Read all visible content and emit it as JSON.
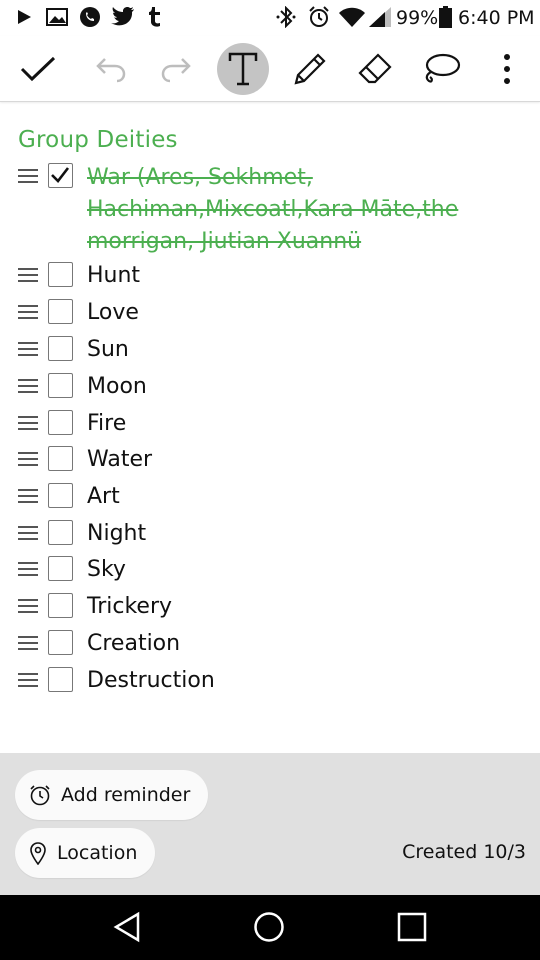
{
  "status_bar": {
    "battery_percent": "99%",
    "time": "6:40 PM",
    "left_icons": [
      "play-store-icon",
      "gallery-icon",
      "phone-icon",
      "twitter-icon",
      "tumblr-icon"
    ],
    "right_icons": [
      "bluetooth-icon",
      "alarm-icon",
      "wifi-icon",
      "cell-signal-icon",
      "battery-icon"
    ]
  },
  "toolbar": {
    "buttons": [
      "check-icon",
      "undo-icon",
      "redo-icon",
      "text-icon",
      "pencil-icon",
      "eraser-icon",
      "lasso-icon",
      "more-icon"
    ],
    "active": "text-icon"
  },
  "note": {
    "group_title": "Group Deities",
    "items": [
      {
        "label": "War (Ares, Sekhmet, Hachiman,Mixcoatl,Kara Māte,the morrigan, Jiutian Xuannü",
        "checked": true
      },
      {
        "label": "Hunt",
        "checked": false
      },
      {
        "label": "Love",
        "checked": false
      },
      {
        "label": "Sun",
        "checked": false
      },
      {
        "label": "Moon",
        "checked": false
      },
      {
        "label": "Fire",
        "checked": false
      },
      {
        "label": "Water",
        "checked": false
      },
      {
        "label": "Art",
        "checked": false
      },
      {
        "label": "Night",
        "checked": false
      },
      {
        "label": "Sky",
        "checked": false
      },
      {
        "label": "Trickery",
        "checked": false
      },
      {
        "label": "Creation",
        "checked": false
      },
      {
        "label": "Destruction",
        "checked": false
      }
    ]
  },
  "footer": {
    "reminder_label": "Add reminder",
    "location_label": "Location",
    "created_label": "Created 10/3"
  },
  "nav_bar": {
    "buttons": [
      "back-icon",
      "home-icon",
      "recents-icon"
    ]
  },
  "colors": {
    "accent_green": "#4caf50",
    "active_tool_bg": "#c4c4c4",
    "bottom_panel_bg": "#e0e0e0",
    "nav_bar_bg": "#000000"
  }
}
